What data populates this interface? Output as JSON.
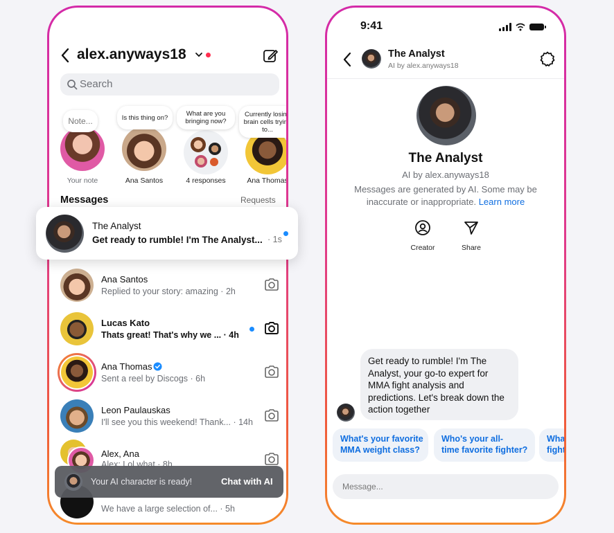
{
  "left": {
    "header": {
      "username": "alex.anyways18"
    },
    "search": {
      "placeholder": "Search"
    },
    "notes": [
      {
        "bubble": "Note...",
        "label": "Your note"
      },
      {
        "bubble": "Is this thing on?",
        "label": "Ana Santos"
      },
      {
        "bubble": "What are you bringing now?",
        "label": "4 responses"
      },
      {
        "bubble": "Currently losing brain cells trying to...",
        "label": "Ana Thomas"
      }
    ],
    "messages_title": "Messages",
    "requests_label": "Requests",
    "featured": {
      "name": "The Analyst",
      "message": "Get ready to rumble! I'm The Analyst...",
      "time": "· 1s"
    },
    "rows": [
      {
        "name": "Ana Santos",
        "sub": "Replied to your story: amazing · 2h"
      },
      {
        "name": "Lucas Kato",
        "sub": "Thats great! That's why we ... · 4h"
      },
      {
        "name": "Ana Thomas",
        "sub": "Sent a reel by Discogs · 6h"
      },
      {
        "name": "Leon Paulauskas",
        "sub": "I'll see you this weekend! Thank... · 14h"
      },
      {
        "name": "Alex, Ana",
        "sub": "Alex: Lol what · 8h"
      },
      {
        "name": "",
        "sub": "We have a large selection of... · 5h"
      }
    ],
    "toast": {
      "text": "Your AI character is ready!",
      "button": "Chat with AI"
    }
  },
  "right": {
    "status_time": "9:41",
    "header": {
      "name": "The Analyst",
      "sub": "AI by alex.anyways18"
    },
    "profile": {
      "name": "The Analyst",
      "sub": "AI by alex.anyways18",
      "disclaimer": "Messages are generated by AI. Some may be inaccurate or inappropriate.",
      "learn_more": "Learn more"
    },
    "actions": {
      "creator": "Creator",
      "share": "Share"
    },
    "message": "Get ready to rumble! I'm The Analyst, your go-to expert for MMA fight analysis and predictions. Let's break down the action together",
    "chips": [
      {
        "line1": "What's your favorite",
        "line2": "MMA weight class?"
      },
      {
        "line1": "Who's your all-",
        "line2": "time favorite fighter?"
      },
      {
        "line1": "What",
        "line2": "fight"
      }
    ],
    "input_placeholder": "Message..."
  },
  "colors": {
    "accent_blue": "#0f6ee0",
    "unread_dot": "#1a8cff",
    "notification_dot": "#ff2e4f",
    "verified": "#1a8cff"
  }
}
